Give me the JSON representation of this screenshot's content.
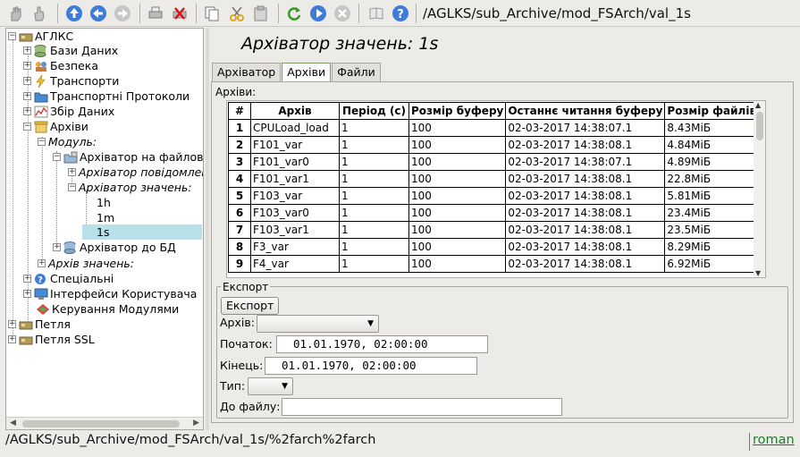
{
  "toolbar": {
    "buttons": [
      "hand-icon",
      "hand-release-icon",
      "up-icon",
      "back-icon",
      "forward-icon",
      "print-icon",
      "delete-icon",
      "copy-icon",
      "cut-icon",
      "paste-icon",
      "refresh-icon",
      "start-icon",
      "stop-icon",
      "book-icon",
      "help-icon"
    ],
    "path": "/AGLKS/sub_Archive/mod_FSArch/val_1s"
  },
  "tree": {
    "root": "АГЛКС",
    "items": {
      "databases": "Бази Даних",
      "security": "Безпека",
      "transports": "Транспорти",
      "transport_protocols": "Транспортні Протоколи",
      "data_acquisition": "Збір Даних",
      "archives": "Архіви",
      "module": "Модуль:",
      "file_archiver": "Архіватор на файлов",
      "message_archiver": "Архіватор повідомлен",
      "value_archiver": "Архіватор значень:",
      "val_1h": "1h",
      "val_1m": "1m",
      "val_1s": "1s",
      "db_archiver": "Архіватор до БД",
      "value_archive": "Архів значень:",
      "specials": "Спеціальні",
      "user_interfaces": "Інтерфейси Користувача",
      "module_control": "Керування Модулями",
      "loop": "Петля",
      "loop_ssl": "Петля SSL"
    }
  },
  "main": {
    "title": "Архіватор значень: 1s",
    "tabs": [
      "Архіватор",
      "Архіви",
      "Файли"
    ],
    "active_tab": "Архіви",
    "archives_label": "Архіви:",
    "table": {
      "headers": [
        "#",
        "Архів",
        "Період (с)",
        "Розмір буферу",
        "Останнє читання буферу",
        "Розмір файлів"
      ],
      "rows": [
        [
          "1",
          "CPULoad_load",
          "1",
          "100",
          "02-03-2017 14:38:07.1",
          "8.43МіБ"
        ],
        [
          "2",
          "F101_var",
          "1",
          "100",
          "02-03-2017 14:38:08.1",
          "4.84МіБ"
        ],
        [
          "3",
          "F101_var0",
          "1",
          "100",
          "02-03-2017 14:38:07.1",
          "4.89МіБ"
        ],
        [
          "4",
          "F101_var1",
          "1",
          "100",
          "02-03-2017 14:38:08.1",
          "22.8МіБ"
        ],
        [
          "5",
          "F103_var",
          "1",
          "100",
          "02-03-2017 14:38:08.1",
          "5.81МіБ"
        ],
        [
          "6",
          "F103_var0",
          "1",
          "100",
          "02-03-2017 14:38:08.1",
          "23.4МіБ"
        ],
        [
          "7",
          "F103_var1",
          "1",
          "100",
          "02-03-2017 14:38:08.1",
          "23.5МіБ"
        ],
        [
          "8",
          "F3_var",
          "1",
          "100",
          "02-03-2017 14:38:08.1",
          "8.29МіБ"
        ],
        [
          "9",
          "F4_var",
          "1",
          "100",
          "02-03-2017 14:38:08.1",
          "6.92МіБ"
        ]
      ]
    },
    "export": {
      "legend": "Експорт",
      "button": "Експорт",
      "archive_label": "Архів:",
      "archive_value": "",
      "begin_label": "Початок:",
      "begin_value": "01.01.1970, 02:00:00",
      "end_label": "Кінець:",
      "end_value": "01.01.1970, 02:00:00",
      "type_label": "Тип:",
      "type_value": "",
      "file_label": "До файлу:",
      "file_value": ""
    }
  },
  "status": {
    "path": "/AGLKS/sub_Archive/mod_FSArch/val_1s/%2farch%2farch",
    "user": "roman"
  }
}
